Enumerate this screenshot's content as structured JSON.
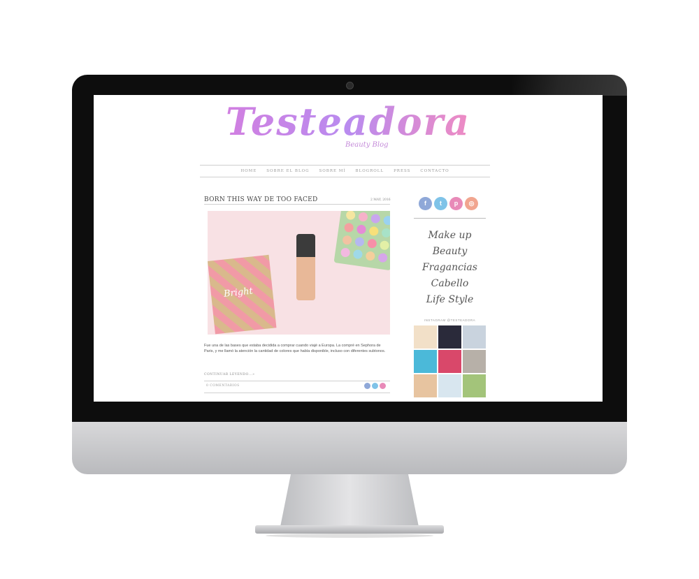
{
  "blog": {
    "title": "Testeadora",
    "tagline": "Beauty Blog"
  },
  "nav": {
    "items": [
      "HOME",
      "SOBRE EL BLOG",
      "SOBRE MÍ",
      "BLOGROLL",
      "PRESS",
      "CONTACTO"
    ]
  },
  "post": {
    "title": "BORN THIS WAY DE TOO FACED",
    "date": "2 MAY, 2016",
    "image_alt_text": "Too Faced Born This Way",
    "excerpt": "Fue una de las bases que estaba decidida a comprar cuando viajé a Europa. La compré en Sephora de Paris, y me llamó la atención la cantidad de colores que había disponible, incluso con diferentes subtonos.",
    "read_more": "CONTINUAR LEYENDO...»",
    "comments": "0 COMENTARIOS",
    "share_icons": [
      "facebook-icon",
      "twitter-icon",
      "pinterest-icon"
    ],
    "photo_text": "Bright"
  },
  "sidebar": {
    "social_icons": [
      {
        "name": "facebook-icon",
        "glyph": "f",
        "color": "#8fa8d8"
      },
      {
        "name": "twitter-icon",
        "glyph": "t",
        "color": "#7fc3e8"
      },
      {
        "name": "pinterest-icon",
        "glyph": "p",
        "color": "#e88ab8"
      },
      {
        "name": "instagram-icon",
        "glyph": "◎",
        "color": "#f1a58f"
      }
    ],
    "categories": [
      "Make up",
      "Beauty",
      "Fragancias",
      "Cabello",
      "Life Style"
    ],
    "instagram_title": "INSTAGRAM @TESTEADORA",
    "instagram_tiles": [
      "#f2e0c8",
      "#2a2a3a",
      "#c9d3de",
      "#4bb9d9",
      "#d9486a",
      "#b7b0a8",
      "#e7c4a0",
      "#d8e6ef",
      "#a3c47a"
    ]
  },
  "colors": {
    "logo_gradient": [
      "#f7a6c6",
      "#d27fe0",
      "#b98bef"
    ],
    "text": "#555555"
  }
}
